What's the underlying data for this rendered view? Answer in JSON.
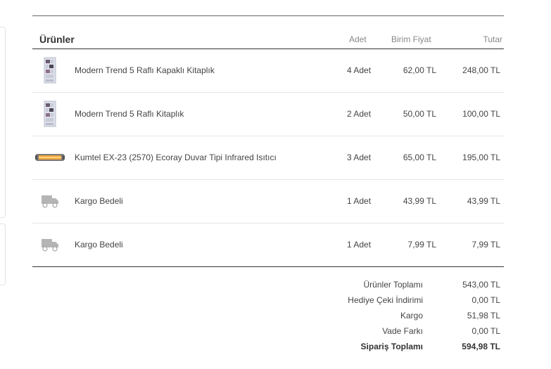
{
  "table": {
    "title": "Ürünler",
    "col_qty": "Adet",
    "col_unit_price": "Birim Fiyat",
    "col_total": "Tutar",
    "rows": [
      {
        "icon": "bookshelf-icon",
        "name": "Modern Trend 5 Raflı Kapaklı Kitaplık",
        "qty": "4 Adet",
        "unit_price": "62,00 TL",
        "total": "248,00 TL"
      },
      {
        "icon": "bookshelf-icon",
        "name": "Modern Trend 5 Raflı Kitaplık",
        "qty": "2 Adet",
        "unit_price": "50,00 TL",
        "total": "100,00 TL"
      },
      {
        "icon": "heater-icon",
        "name": "Kumtel EX-23 (2570) Ecoray Duvar Tipi Infrared Isıtıcı",
        "qty": "3 Adet",
        "unit_price": "65,00 TL",
        "total": "195,00 TL"
      },
      {
        "icon": "truck-icon",
        "name": "Kargo Bedeli",
        "qty": "1 Adet",
        "unit_price": "43,99 TL",
        "total": "43,99 TL"
      },
      {
        "icon": "truck-icon",
        "name": "Kargo Bedeli",
        "qty": "1 Adet",
        "unit_price": "7,99 TL",
        "total": "7,99 TL"
      }
    ]
  },
  "summary": {
    "products_total_label": "Ürünler Toplamı",
    "products_total_value": "543,00 TL",
    "gift_discount_label": "Hediye Çeki İndirimi",
    "gift_discount_value": "0,00 TL",
    "shipping_label": "Kargo",
    "shipping_value": "51,98 TL",
    "term_difference_label": "Vade Farkı",
    "term_difference_value": "0,00 TL",
    "order_total_label": "Sipariş Toplamı",
    "order_total_value": "594,98 TL"
  }
}
